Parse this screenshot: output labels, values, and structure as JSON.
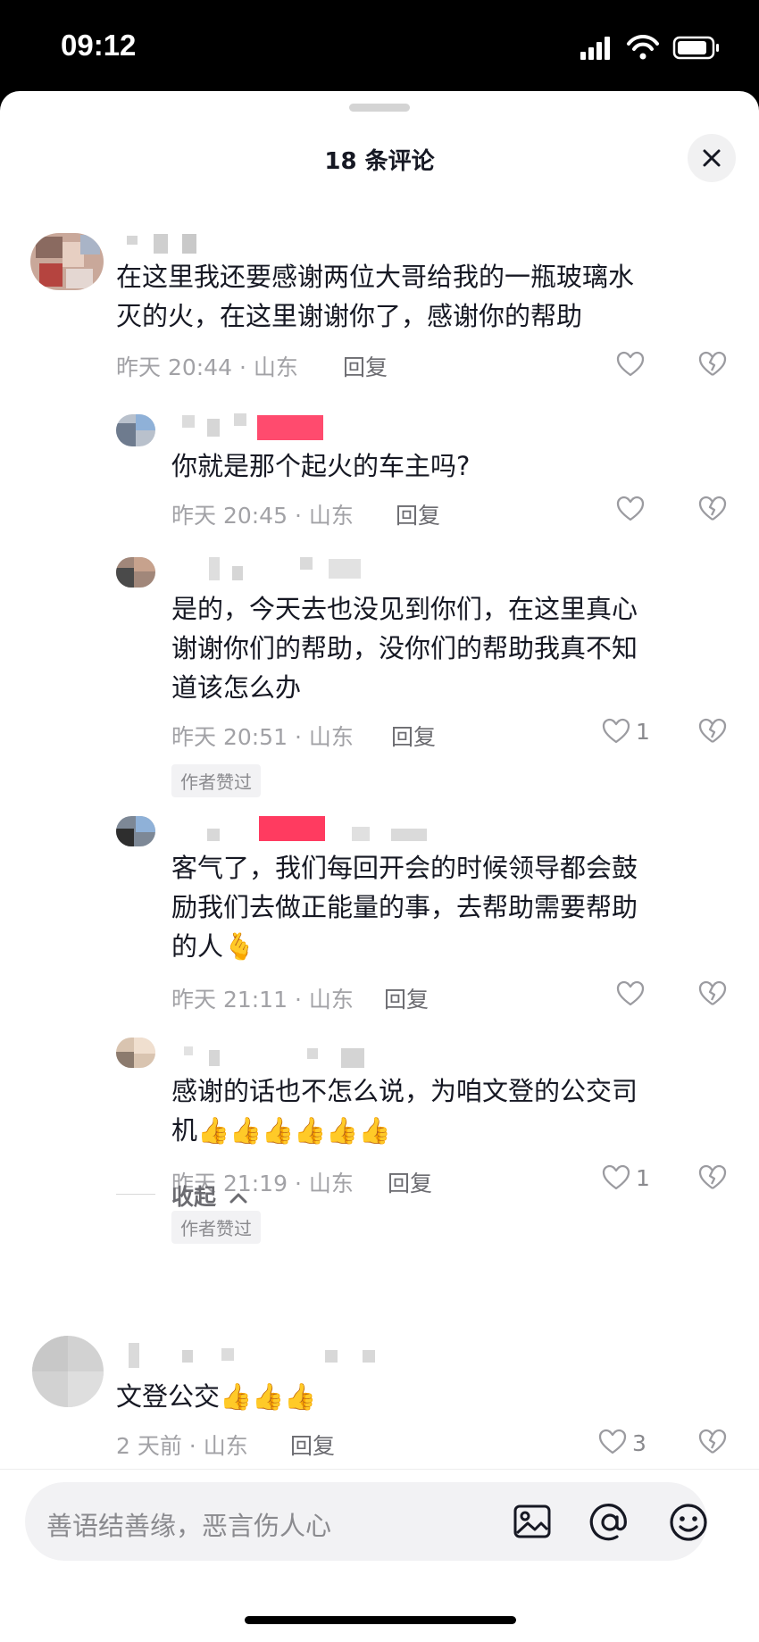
{
  "status_bar": {
    "time": "09:12"
  },
  "header": {
    "title": "18 条评论"
  },
  "comments": [
    {
      "text": "在这里我还要感谢两位大哥给我的一瓶玻璃水\n灭的火，在这里谢谢你了，感谢你的帮助",
      "meta": "昨天 20:44 · 山东",
      "reply": "回复",
      "likes": ""
    },
    {
      "text": "你就是那个起火的车主吗?",
      "meta": "昨天 20:45 · 山东",
      "reply": "回复",
      "likes": ""
    },
    {
      "text": "是的，今天去也没见到你们，在这里真心\n谢谢你们的帮助，没你们的帮助我真不知\n道该怎么办",
      "meta": "昨天 20:51 · 山东",
      "reply": "回复",
      "likes": "1",
      "badge": "作者赞过"
    },
    {
      "text": "客气了，我们每回开会的时候领导都会鼓\n励我们去做正能量的事，去帮助需要帮助\n的人🫰",
      "meta": "昨天 21:11 · 山东",
      "reply": "回复",
      "likes": ""
    },
    {
      "text": "感谢的话也不怎么说，为咱文登的公交司\n机👍👍👍👍👍👍",
      "meta": "昨天 21:19 · 山东",
      "reply": "回复",
      "likes": "1",
      "badge": "作者赞过"
    },
    {
      "text": "文登公交👍👍👍",
      "meta": "2 天前 · 山东",
      "reply": "回复",
      "likes": "3"
    }
  ],
  "collapse_label": "收起",
  "input": {
    "placeholder": "善语结善缘，恶言伤人心"
  },
  "colors": {
    "text": "#161823",
    "meta": "#a2a2a6",
    "accent": "#fe2c55"
  },
  "icons": [
    "close-icon",
    "heart-icon",
    "dislike-icon",
    "image-icon",
    "at-icon",
    "emoji-icon",
    "chevron-up-icon"
  ]
}
